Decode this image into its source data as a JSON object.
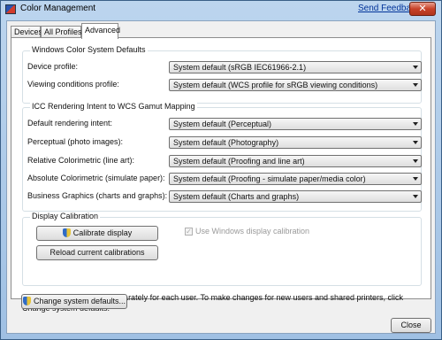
{
  "window": {
    "title": "Color Management",
    "feedback_link": "Send Feedback",
    "close_glyph": "✕"
  },
  "tabs": [
    {
      "label": "Devices",
      "active": false
    },
    {
      "label": "All Profiles",
      "active": false
    },
    {
      "label": "Advanced",
      "active": true
    }
  ],
  "wcs_defaults": {
    "title": "Windows Color System Defaults",
    "rows": [
      {
        "label": "Device profile:",
        "value": "System default (sRGB IEC61966-2.1)"
      },
      {
        "label": "Viewing conditions profile:",
        "value": "System default (WCS profile for sRGB viewing conditions)"
      }
    ]
  },
  "icc_mapping": {
    "title": "ICC Rendering Intent to WCS Gamut Mapping",
    "rows": [
      {
        "label": "Default rendering intent:",
        "value": "System default (Perceptual)"
      },
      {
        "label": "Perceptual (photo images):",
        "value": "System default (Photography)"
      },
      {
        "label": "Relative Colorimetric (line art):",
        "value": "System default (Proofing and line art)"
      },
      {
        "label": "Absolute Colorimetric (simulate paper):",
        "value": "System default (Proofing - simulate paper/media color)"
      },
      {
        "label": "Business Graphics (charts and graphs):",
        "value": "System default (Charts and graphs)"
      }
    ]
  },
  "calibration": {
    "title": "Display Calibration",
    "calibrate_button": "Calibrate display",
    "reload_button": "Reload current calibrations",
    "use_windows_calibration_label": "Use Windows display calibration",
    "check_glyph": "✓"
  },
  "footer": {
    "note": "Color settings are stored separately for each user. To make changes for new users and shared printers, click Change system defaults.",
    "change_defaults_button": "Change system defaults...",
    "close_button": "Close"
  }
}
